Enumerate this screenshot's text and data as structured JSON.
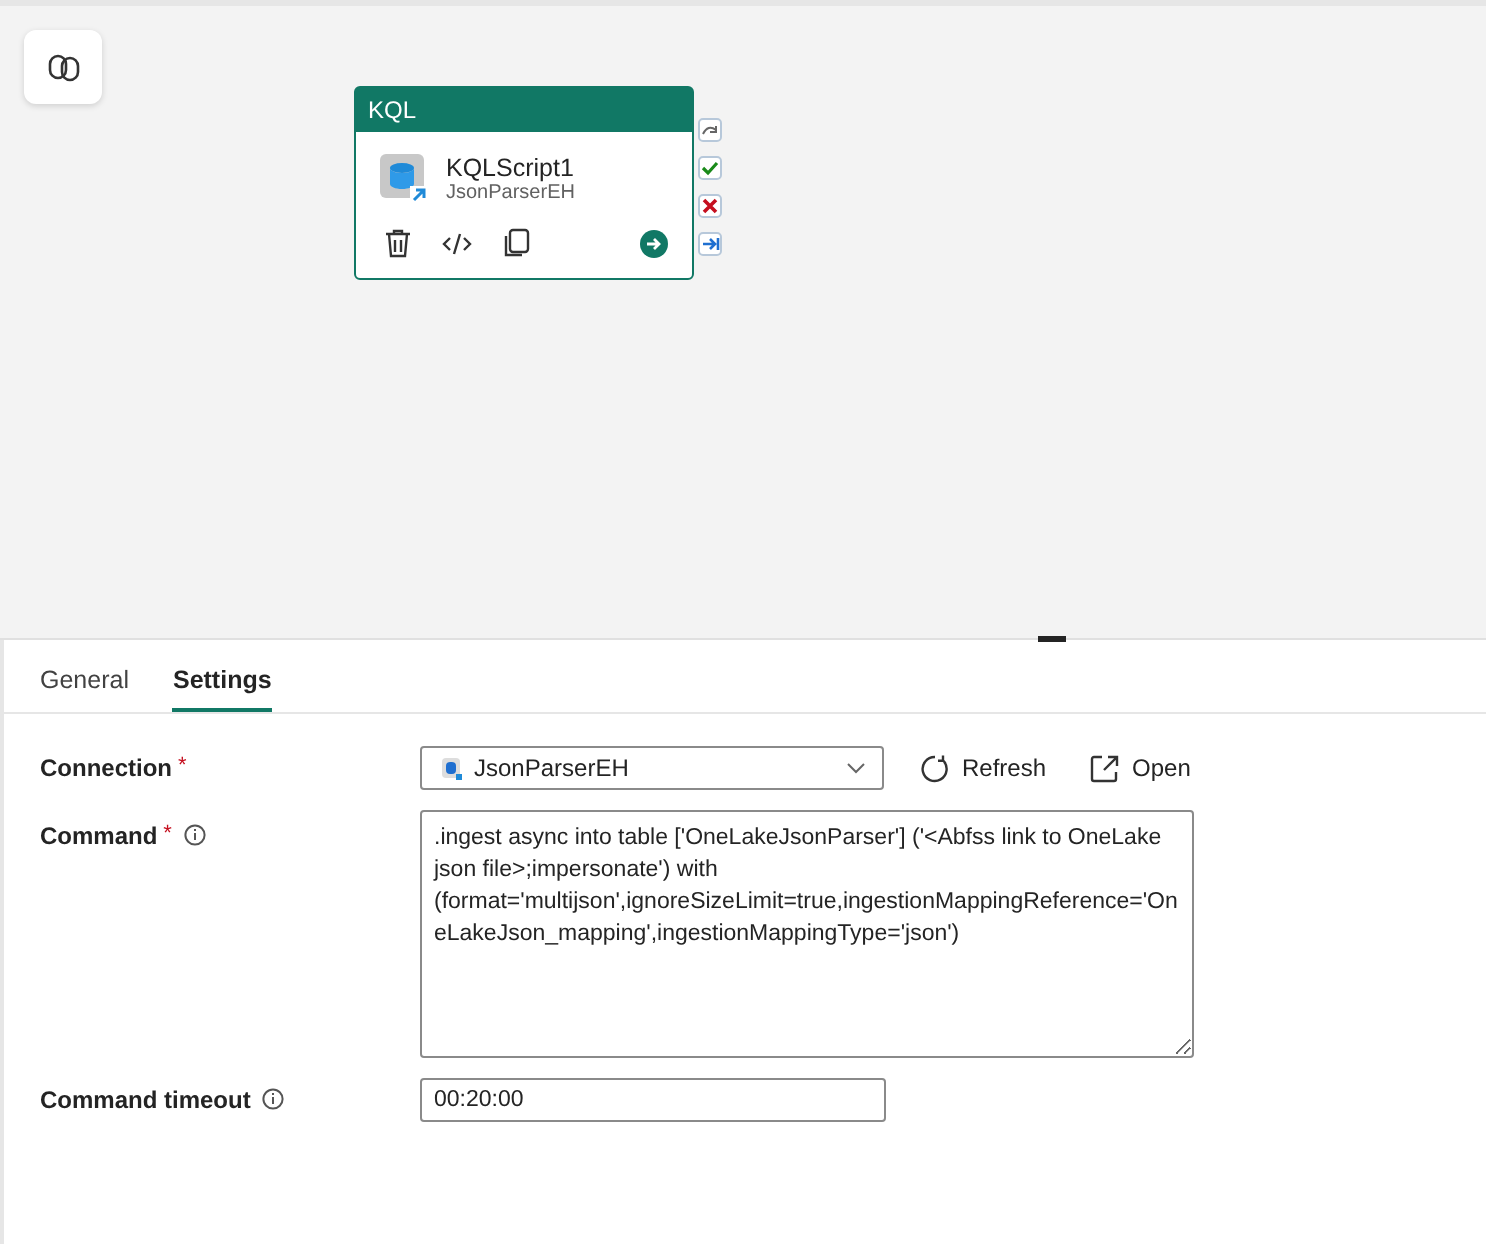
{
  "canvas": {
    "activity": {
      "type": "KQL",
      "name": "KQLScript1",
      "connection": "JsonParserEH"
    }
  },
  "tabs": [
    {
      "label": "General",
      "selected": false
    },
    {
      "label": "Settings",
      "selected": true
    }
  ],
  "settings": {
    "connection": {
      "label": "Connection",
      "required_mark": "*",
      "value": "JsonParserEH",
      "actions": [
        "Refresh",
        "Open"
      ]
    },
    "command": {
      "label": "Command",
      "required_mark": "*",
      "value": ".ingest async into table ['OneLakeJsonParser'] ('<Abfss link to OneLake json file>;impersonate') with (format='multijson',ignoreSizeLimit=true,ingestionMappingReference='OneLakeJson_mapping',ingestionMappingType='json')"
    },
    "timeout": {
      "label": "Command timeout",
      "value": "00:20:00"
    }
  }
}
